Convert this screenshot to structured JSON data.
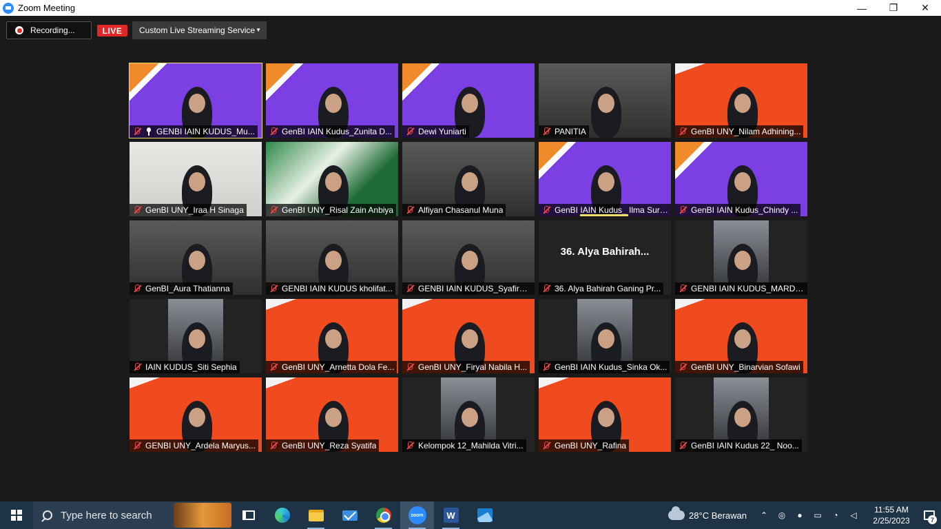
{
  "window": {
    "title": "Zoom Meeting",
    "minimize": "—",
    "maximize": "❐",
    "close": "✕"
  },
  "toolbar": {
    "recording_label": "Recording...",
    "live_label": "LIVE",
    "stream_service": "Custom Live Streaming Service"
  },
  "colors": {
    "purple_bg": "#7b3fe4",
    "orange_bg": "#f04b1e",
    "live_red": "#e02828",
    "active_outline": "#f0e06a",
    "taskbar": "#1f3346"
  },
  "gallery": {
    "tiles": [
      {
        "name": "GENBI IAIN KUDUS_Mu...",
        "bg": "purple",
        "pinned": true,
        "active": true
      },
      {
        "name": "GenBI IAIN Kudus_Zunita D...",
        "bg": "purple"
      },
      {
        "name": "Dewi Yuniarti",
        "bg": "purple"
      },
      {
        "name": "PANITIA",
        "bg": "room"
      },
      {
        "name": "GenBI UNY_Nilam Adhining...",
        "bg": "orange"
      },
      {
        "name": "GenBI UNY_Iraa H Sinaga",
        "bg": "light"
      },
      {
        "name": "GenBI UNY_Risal Zain Anbiya",
        "bg": "green"
      },
      {
        "name": "Alfiyan Chasanul Muna",
        "bg": "room"
      },
      {
        "name": "GenBI IAIN Kudus_ Ilma Sururi...",
        "bg": "purple",
        "speaking": true
      },
      {
        "name": "GenBI IAIN Kudus_Chindy ...",
        "bg": "purple"
      },
      {
        "name": "GenBI_Aura Thatianna",
        "bg": "room"
      },
      {
        "name": "GENBI IAIN KUDUS kholifat...",
        "bg": "room"
      },
      {
        "name": "GENBI IAIN KUDUS_Syafira ...",
        "bg": "room"
      },
      {
        "name": "36. Alya Bahirah Ganing Pr...",
        "bg": "dark",
        "center_label": "36. Alya Bahirah..."
      },
      {
        "name": "GENBI IAIN KUDUS_MARDL...",
        "bg": "small-photo"
      },
      {
        "name": "IAIN KUDUS_Siti Sephia",
        "bg": "small-photo"
      },
      {
        "name": "GenBI UNY_Arnetta Dola Fe...",
        "bg": "orange"
      },
      {
        "name": "GenBI UNY_Firyal Nabila H...",
        "bg": "orange"
      },
      {
        "name": "GenBI IAIN Kudus_Sinka Ok...",
        "bg": "small-photo"
      },
      {
        "name": "GenBI UNY_Binarvian Sofawi",
        "bg": "orange"
      },
      {
        "name": "GENBI UNY_Ardela Maryus...",
        "bg": "orange"
      },
      {
        "name": "GenBI UNY_Reza Syatifa",
        "bg": "orange"
      },
      {
        "name": "Kelompok 12_Mahilda Vitri...",
        "bg": "small-photo"
      },
      {
        "name": "GenBI UNY_Rafina",
        "bg": "orange"
      },
      {
        "name": "GenBI IAIN Kudus 22_ Noo...",
        "bg": "small-photo"
      }
    ]
  },
  "taskbar": {
    "search_placeholder": "Type here to search",
    "weather": "28°C  Berawan",
    "time": "11:55 AM",
    "date": "2/25/2023",
    "notification_count": "7",
    "zoom_label": "zoom",
    "word_label": "W"
  }
}
